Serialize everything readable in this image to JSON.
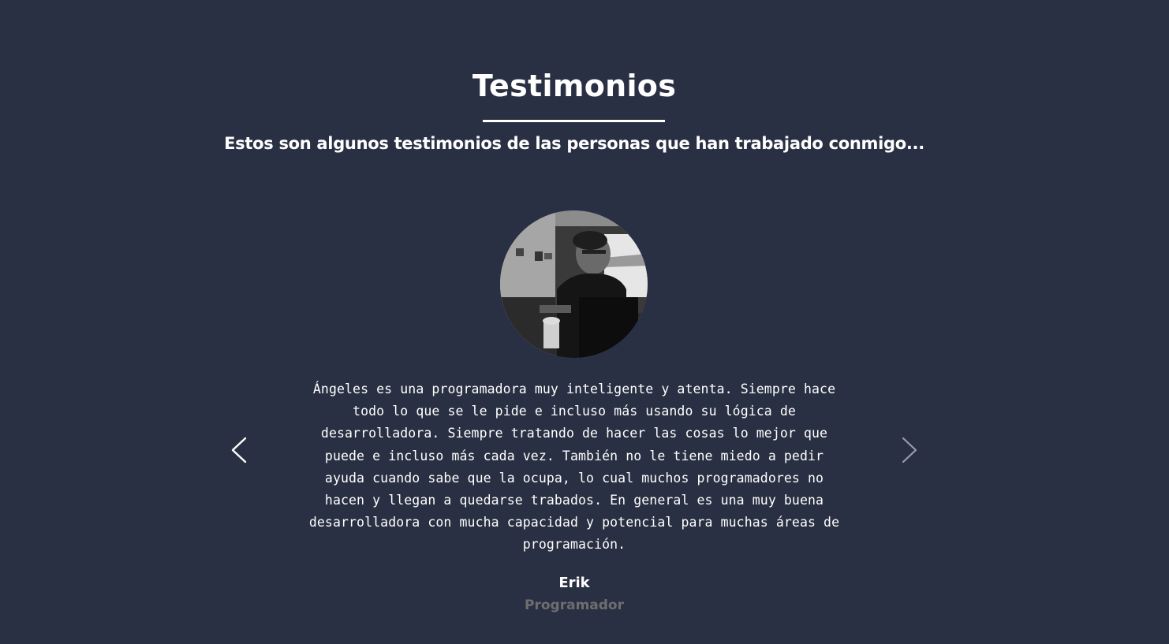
{
  "section": {
    "title": "Testimonios",
    "subtitle": "Estos son algunos testimonios de las personas que han trabajado conmigo..."
  },
  "testimonial": {
    "avatar_alt": "Erik",
    "quote": "Ángeles es una programadora muy inteligente y atenta. Siempre hace todo lo que se le pide e incluso más usando su lógica de desarrolladora. Siempre tratando de hacer las cosas lo mejor que puede e incluso más cada vez. También no le tiene miedo a pedir ayuda cuando sabe que la ocupa, lo cual muchos programadores no hacen y llegan a quedarse trabados. En general es una muy buena desarrolladora con mucha capacidad y potencial para muchas áreas de programación.",
    "author_name": "Erik",
    "author_role": "Programador"
  },
  "carousel": {
    "prev_icon": "chevron-left-icon",
    "next_icon": "chevron-right-icon"
  },
  "colors": {
    "background": "#2a3043",
    "text": "#ffffff",
    "role_text": "#6e6e6e",
    "next_arrow": "#9a9ca6"
  }
}
